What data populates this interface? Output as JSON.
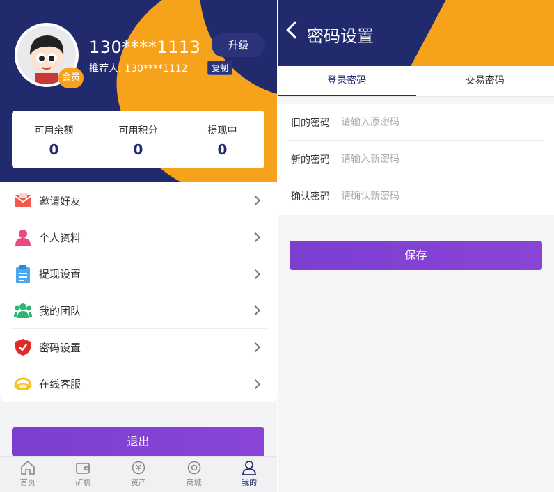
{
  "profile": {
    "phone": "130****1113",
    "upgrade_label": "升级",
    "referrer": "推荐人: 130****1112",
    "copy_label": "复制",
    "member_badge": "会员"
  },
  "stats": [
    {
      "label": "可用余额",
      "value": "0"
    },
    {
      "label": "可用积分",
      "value": "0"
    },
    {
      "label": "提现中",
      "value": "0"
    }
  ],
  "menu": [
    {
      "label": "邀请好友",
      "icon": "envelope-icon",
      "color": "#f25b4b"
    },
    {
      "label": "个人资料",
      "icon": "person-icon",
      "color": "#e94b7e"
    },
    {
      "label": "提现设置",
      "icon": "clipboard-icon",
      "color": "#4aa8f0"
    },
    {
      "label": "我的团队",
      "icon": "team-icon",
      "color": "#2bb673"
    },
    {
      "label": "密码设置",
      "icon": "shield-icon",
      "color": "#e02a2a"
    },
    {
      "label": "在线客服",
      "icon": "headset-icon",
      "color": "#f5c21b"
    }
  ],
  "logout_label": "退出",
  "tabbar": [
    {
      "label": "首页",
      "icon": "home-icon"
    },
    {
      "label": "矿机",
      "icon": "wallet-icon"
    },
    {
      "label": "资产",
      "icon": "asset-icon"
    },
    {
      "label": "商城",
      "icon": "mall-icon"
    },
    {
      "label": "我的",
      "icon": "user-icon",
      "active": true
    }
  ],
  "password_page": {
    "title": "密码设置",
    "tabs": [
      "登录密码",
      "交易密码"
    ],
    "fields": [
      {
        "label": "旧的密码",
        "placeholder": "请输入原密码"
      },
      {
        "label": "新的密码",
        "placeholder": "请输入新密码"
      },
      {
        "label": "确认密码",
        "placeholder": "请确认新密码"
      }
    ],
    "save_label": "保存"
  },
  "colors": {
    "navy": "#222a6e",
    "orange": "#f7a21b",
    "purple": "#7b3fd0"
  }
}
